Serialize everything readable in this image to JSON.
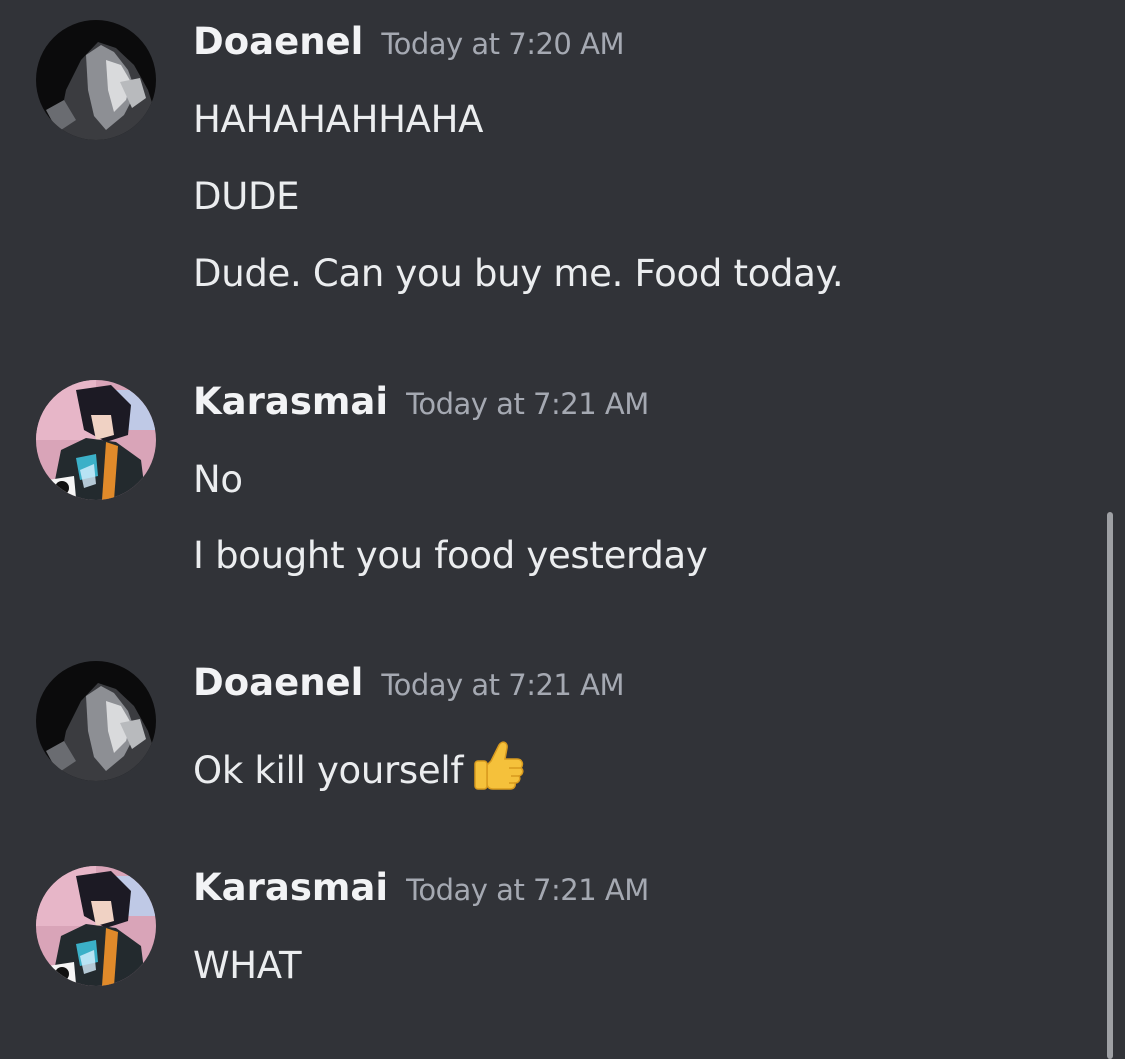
{
  "colors": {
    "background": "#313338",
    "username": "#f2f3f5",
    "timestamp": "#a5a9b2",
    "message_text": "#ebedef",
    "scrollbar": "#b5b7bb"
  },
  "messages": [
    {
      "username": "Doaenel",
      "timestamp": "Today at 7:20 AM",
      "avatar": "dark-monochrome-avatar",
      "lines": [
        "HAHAHAHHAHA",
        "DUDE",
        "Dude. Can you buy me. Food today."
      ]
    },
    {
      "username": "Karasmai",
      "timestamp": "Today at 7:21 AM",
      "avatar": "anime-character-avatar",
      "lines": [
        "No",
        "I bought you food yesterday"
      ]
    },
    {
      "username": "Doaenel",
      "timestamp": "Today at 7:21 AM",
      "avatar": "dark-monochrome-avatar",
      "lines": [
        "Ok kill yourself"
      ],
      "emoji": "thumbs-up-emoji"
    },
    {
      "username": "Karasmai",
      "timestamp": "Today at 7:21 AM",
      "avatar": "anime-character-avatar",
      "lines": [
        "WHAT"
      ]
    }
  ]
}
